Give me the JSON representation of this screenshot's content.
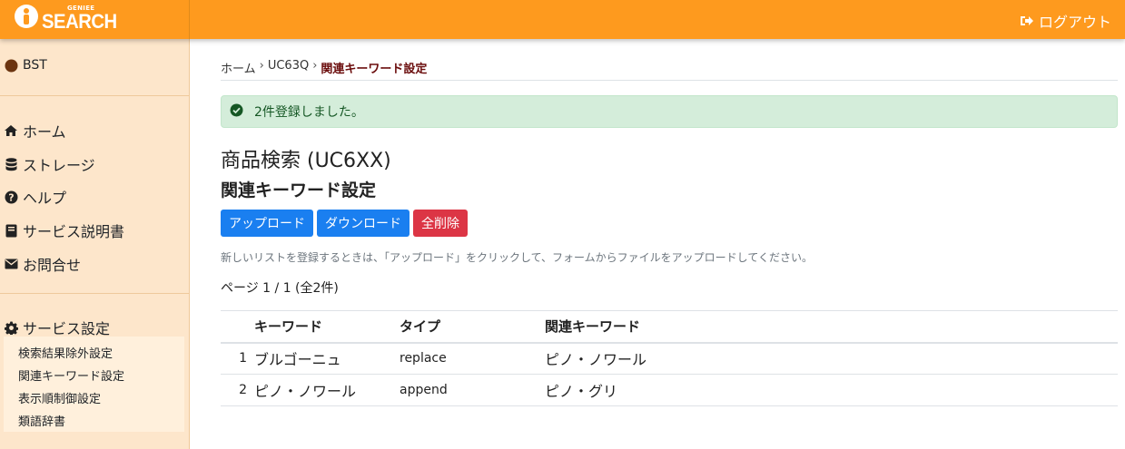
{
  "header": {
    "logo_small": "GENIEE",
    "logo_text": "SEARCH",
    "logout_label": "ログアウト"
  },
  "sidebar": {
    "account": "BST",
    "nav": [
      {
        "label": "ホーム",
        "icon": "home-icon"
      },
      {
        "label": "ストレージ",
        "icon": "database-icon"
      },
      {
        "label": "ヘルプ",
        "icon": "question-circle-icon"
      },
      {
        "label": "サービス説明書",
        "icon": "book-icon"
      },
      {
        "label": "お問合せ",
        "icon": "envelope-icon"
      }
    ],
    "settings": {
      "label": "サービス設定",
      "icon": "gear-icon",
      "items": [
        "検索結果除外設定",
        "関連キーワード設定",
        "表示順制御設定",
        "類語辞書"
      ]
    }
  },
  "breadcrumb": {
    "items": [
      "ホーム",
      "UC63Q"
    ],
    "current": "関連キーワード設定",
    "separator": "›"
  },
  "alert": {
    "message": "2件登録しました。",
    "icon": "check-circle-icon"
  },
  "main": {
    "page_title": "商品検索 (UC6XX)",
    "section_title": "関連キーワード設定",
    "buttons": {
      "upload": "アップロード",
      "download": "ダウンロード",
      "delete_all": "全削除"
    },
    "help_text": "新しいリストを登録するときは、「アップロード」をクリックして、フォームからファイルをアップロードしてください。",
    "pager": "ページ 1 / 1 (全2件)"
  },
  "table": {
    "headers": [
      "キーワード",
      "タイプ",
      "関連キーワード"
    ],
    "rows": [
      {
        "index": "1",
        "keyword": "ブルゴーニュ",
        "type": "replace",
        "related": "ピノ・ノワール"
      },
      {
        "index": "2",
        "keyword": "ピノ・ノワール",
        "type": "append",
        "related": "ピノ・グリ"
      }
    ]
  },
  "colors": {
    "header_bg": "#fe9a1e",
    "sidebar_bg": "#fde6cb",
    "primary": "#1a7ff0",
    "danger": "#dc3545",
    "success_bg": "#d4edda"
  }
}
